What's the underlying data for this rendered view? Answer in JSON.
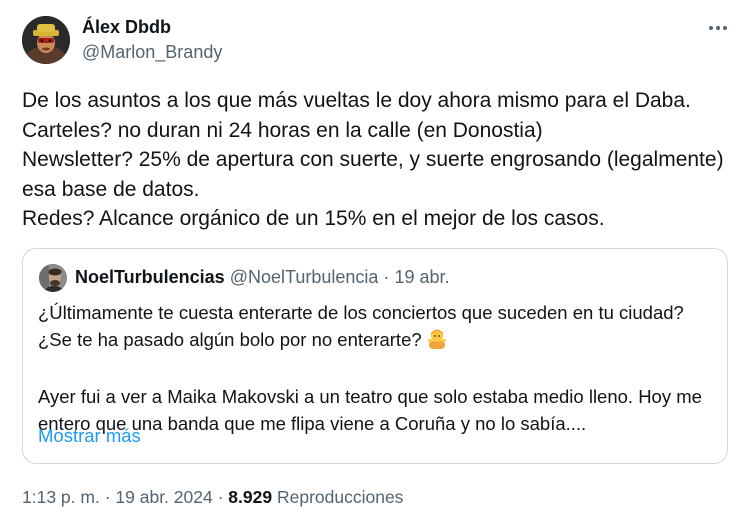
{
  "author": {
    "display_name": "Álex Dbdb",
    "handle": "@Marlon_Brandy"
  },
  "tweet": {
    "text": "De los asuntos a los que más vueltas le doy ahora mismo para el Daba.\nCarteles? no duran ni 24 horas en la calle (en Donostia)\nNewsletter? 25% de apertura con suerte, y suerte engrosando (legalmente) esa base de datos.\nRedes? Alcance orgánico de un 15% en el mejor de los casos."
  },
  "quoted": {
    "display_name": "NoelTurbulencias",
    "handle": "@NoelTurbulencia",
    "separator": "·",
    "date": "19 abr.",
    "text_line1": "¿Últimamente te cuesta enterarte de los conciertos que suceden en tu ciudad?",
    "text_line2": "¿Se te ha pasado algún bolo por no enterarte?",
    "emoji": "person-shrugging",
    "text_para2": "Ayer fui a ver a Maika Makovski a un teatro que solo estaba medio lleno. Hoy me entero que una banda que me flipa viene a Coruña y no lo sabía....",
    "show_more": "Mostrar más"
  },
  "meta": {
    "time": "1:13 p. m.",
    "sep1": "·",
    "date": "19 abr. 2024",
    "sep2": "·",
    "views_count": "8.929",
    "views_label": "Reproducciones"
  },
  "icons": {
    "more": "more-horizontal-icon"
  },
  "colors": {
    "text": "#0f1419",
    "secondary": "#536471",
    "link": "#1d9bf0",
    "border": "#cfd9de"
  }
}
